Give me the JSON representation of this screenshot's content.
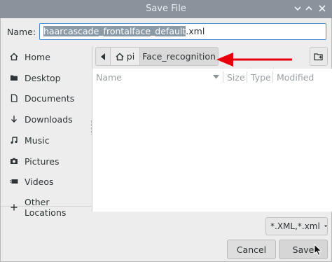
{
  "window": {
    "title": "Save File"
  },
  "name_row": {
    "label": "Name:",
    "value_selected": "haarcascade_frontalface_default",
    "value_suffix": ".xml"
  },
  "sidebar": {
    "items": [
      {
        "label": "Home",
        "icon": "home-icon"
      },
      {
        "label": "Desktop",
        "icon": "folder-icon"
      },
      {
        "label": "Documents",
        "icon": "document-icon"
      },
      {
        "label": "Downloads",
        "icon": "arrow-down-icon"
      },
      {
        "label": "Music",
        "icon": "music-icon"
      },
      {
        "label": "Pictures",
        "icon": "camera-icon"
      },
      {
        "label": "Videos",
        "icon": "video-icon"
      }
    ],
    "other": {
      "label": "Other Locations",
      "icon": "plus-icon"
    }
  },
  "pathbar": {
    "home_label": "pi",
    "current_label": "Face_recognition"
  },
  "columns": {
    "name": "Name",
    "size": "Size",
    "type": "Type",
    "modified": "Modified"
  },
  "filter": {
    "selected": "*.XML,*.xml"
  },
  "buttons": {
    "cancel": "Cancel",
    "save": "Save"
  },
  "colors": {
    "titlebar": "#8a939c",
    "selection": "#8a9aa7",
    "focus_border": "#4d8fd6",
    "annotation_arrow": "#e8000b"
  }
}
